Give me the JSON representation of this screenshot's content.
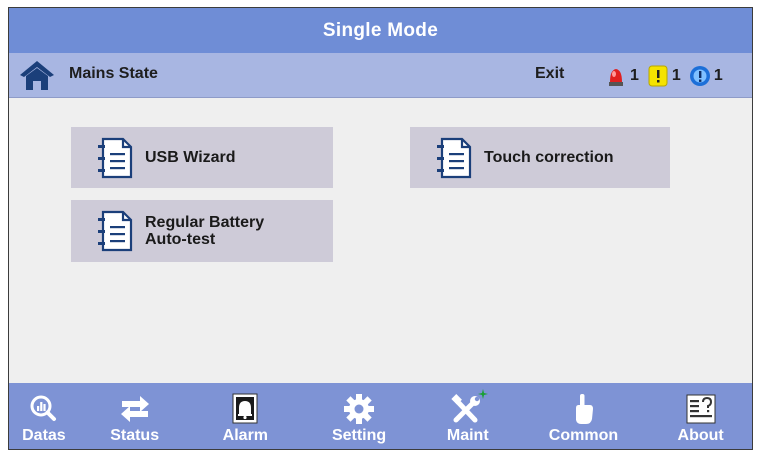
{
  "title": "Single Mode",
  "status_bar": {
    "state_label": "Mains State",
    "exit_label": "Exit",
    "alarms": [
      {
        "icon": "red-alarm-icon",
        "count": "1",
        "color": "#e02020"
      },
      {
        "icon": "yellow-warning-icon",
        "count": "1",
        "color": "#f5e300"
      },
      {
        "icon": "blue-info-icon",
        "count": "1",
        "color": "#1c6fd8"
      }
    ]
  },
  "menu": {
    "usb_wizard": "USB Wizard",
    "touch_correction": "Touch correction",
    "regular_battery_line1": "Regular Battery",
    "regular_battery_line2": "Auto-test"
  },
  "nav": [
    {
      "label": "Datas",
      "icon": "datas-icon"
    },
    {
      "label": "Status",
      "icon": "status-arrows-icon"
    },
    {
      "label": "Alarm",
      "icon": "alarm-bell-icon"
    },
    {
      "label": "Setting",
      "icon": "gear-icon"
    },
    {
      "label": "Maint",
      "icon": "tools-icon"
    },
    {
      "label": "Common",
      "icon": "hand-pointer-icon"
    },
    {
      "label": "About",
      "icon": "about-icon"
    }
  ],
  "colors": {
    "title_bar": "#6f8dd6",
    "status_bar": "#a8b6e2",
    "nav_bar": "#7e93d5",
    "menu_button": "#cecbd8",
    "background": "#efefef"
  }
}
